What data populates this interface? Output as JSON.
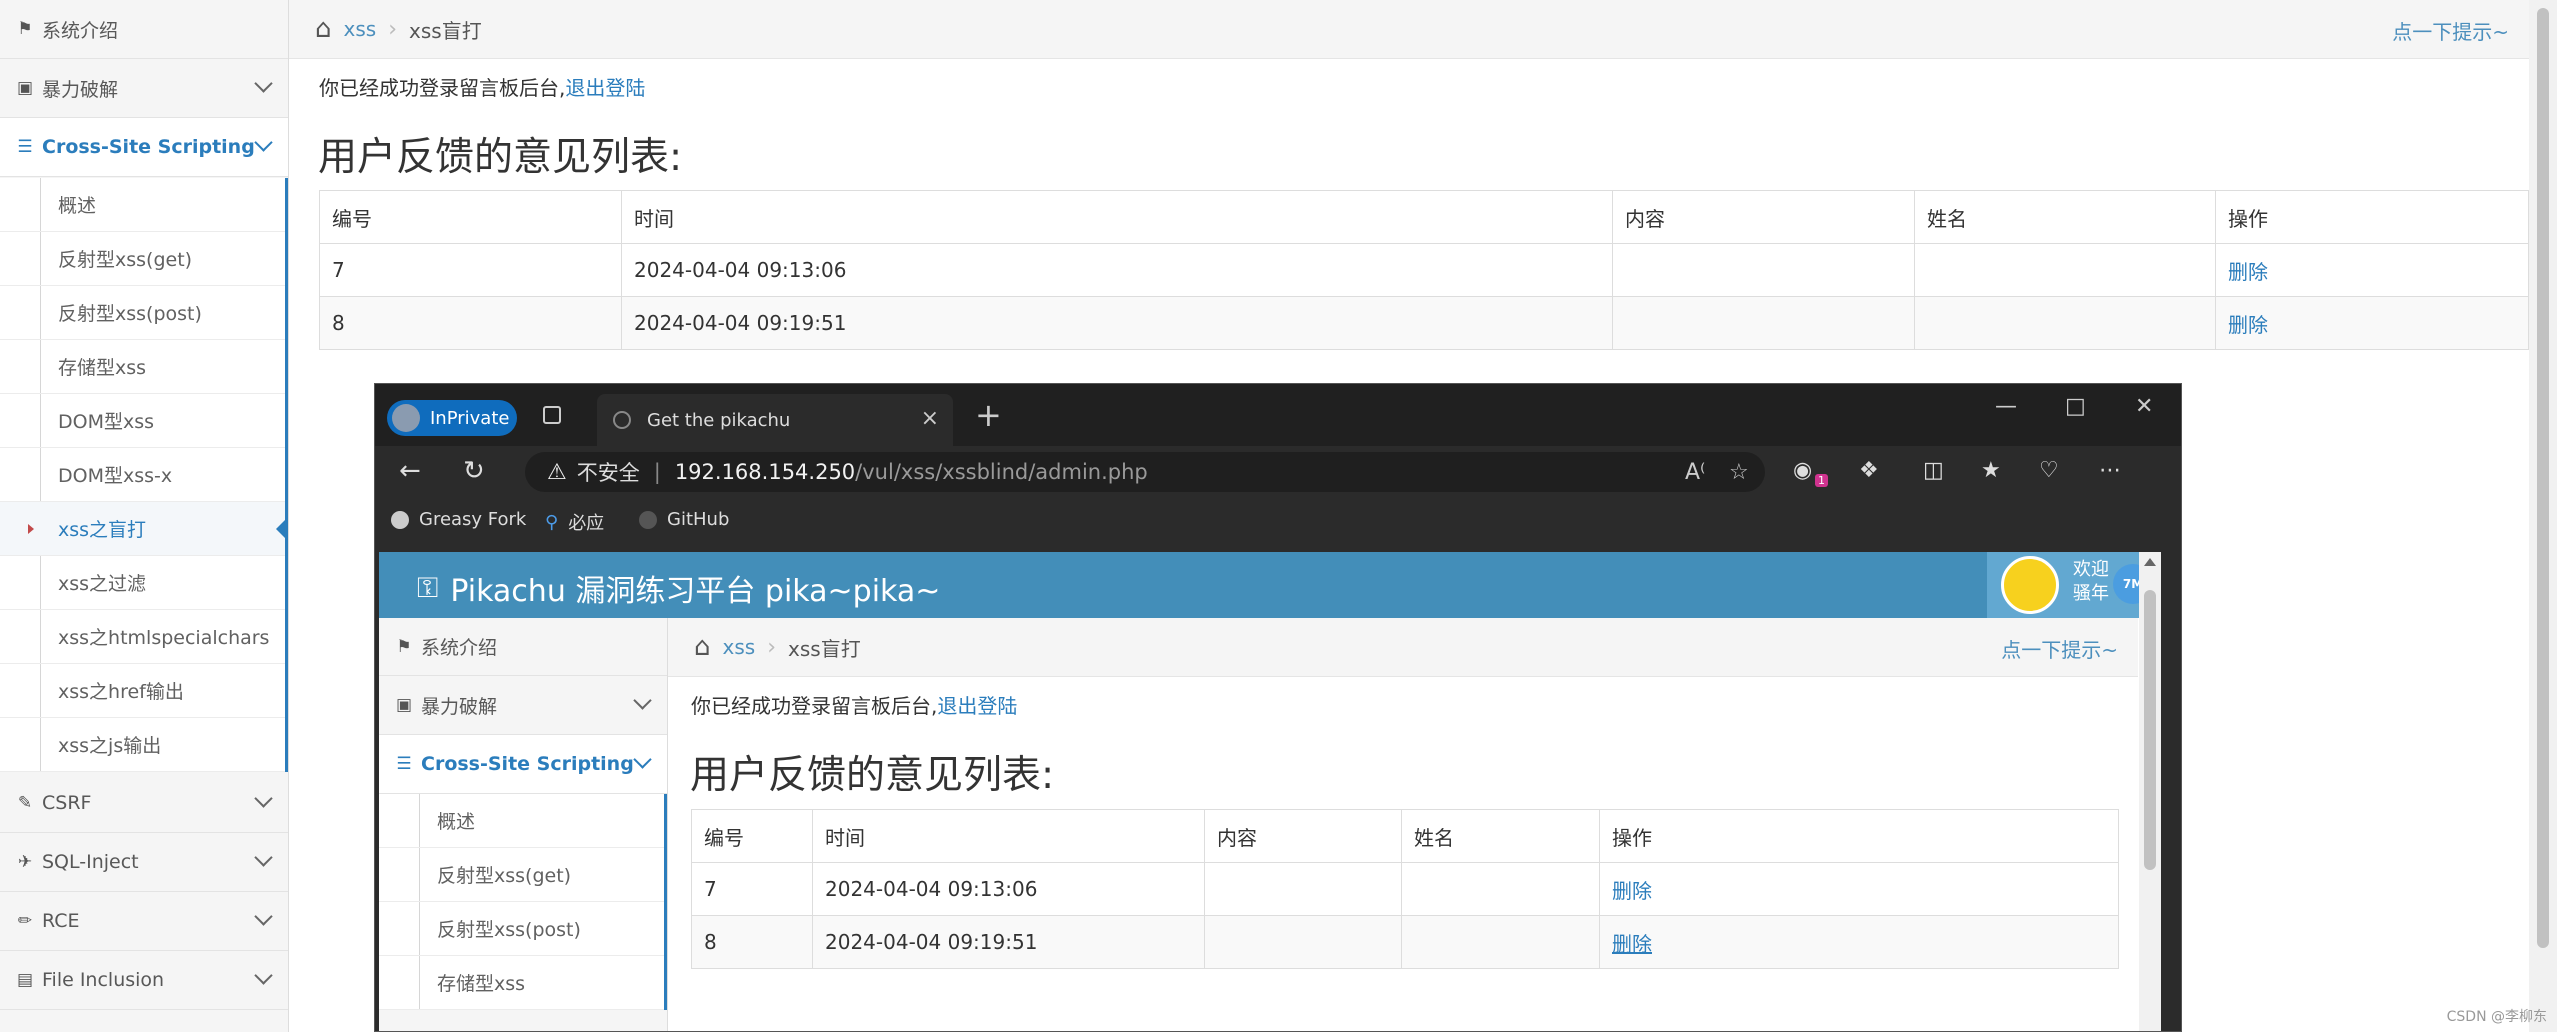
{
  "sidebar": {
    "items": [
      {
        "label": "系统介绍",
        "icon": "tag-icon"
      },
      {
        "label": "暴力破解",
        "icon": "lock-icon"
      },
      {
        "label": "Cross-Site Scripting",
        "icon": "list-icon"
      },
      {
        "label": "CSRF",
        "icon": "share-icon"
      },
      {
        "label": "SQL-Inject",
        "icon": "plane-icon"
      },
      {
        "label": "RCE",
        "icon": "pencil-icon"
      },
      {
        "label": "File Inclusion",
        "icon": "file-icon"
      }
    ],
    "xss_submenu": [
      "概述",
      "反射型xss(get)",
      "反射型xss(post)",
      "存储型xss",
      "DOM型xss",
      "DOM型xss-x",
      "xss之盲打",
      "xss之过滤",
      "xss之htmlspecialchars",
      "xss之href输出",
      "xss之js输出"
    ]
  },
  "breadcrumb": {
    "parent": "xss",
    "current": "xss盲打",
    "hint": "点一下提示~"
  },
  "login": {
    "message": "你已经成功登录留言板后台,",
    "logout": "退出登陆"
  },
  "list": {
    "title": "用户反馈的意见列表:",
    "headers": [
      "编号",
      "时间",
      "内容",
      "姓名",
      "操作"
    ],
    "rows": [
      {
        "id": "7",
        "time": "2024-04-04 09:13:06",
        "content": "",
        "name": "",
        "action": "删除"
      },
      {
        "id": "8",
        "time": "2024-04-04 09:19:51",
        "content": "",
        "name": "",
        "action": "删除"
      }
    ]
  },
  "browser": {
    "inprivate": "InPrivate",
    "tab_title": "Get the pikachu",
    "insecure": "不安全",
    "url_host": "192.168.154.250",
    "url_path": "/vul/xss/xssblind/admin.php",
    "favorites": [
      "Greasy Fork",
      "必应",
      "GitHub"
    ],
    "ext_badge": "1"
  },
  "pikachu": {
    "header": "Pikachu 漏洞练习平台 pika~pika~",
    "welcome": "欢迎",
    "user": "骚年",
    "badge": "7M"
  },
  "watermark": "CSDN @李柳东",
  "colors": {
    "accent": "#2b7dbc",
    "header": "#438eb9"
  }
}
